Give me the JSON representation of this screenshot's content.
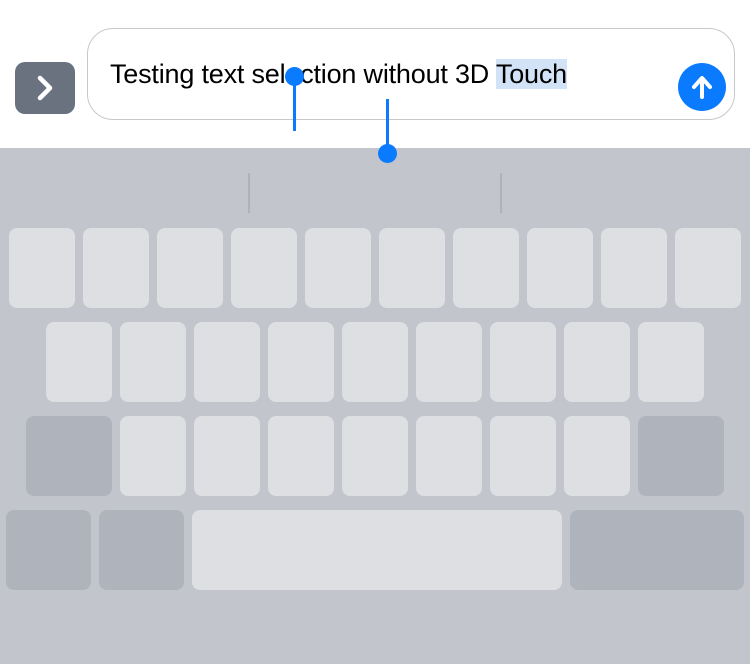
{
  "input": {
    "text_before_selection": "Testing text selection without 3D ",
    "selected_text": "Touch",
    "text_after_selection": ""
  },
  "colors": {
    "accent": "#0a7bff",
    "keyboard_bg": "#c2c5cb",
    "key_light": "#dedfe3",
    "key_dark": "#afb3bb",
    "expand_button": "#6a7280",
    "selection": "#d2e3f7"
  }
}
